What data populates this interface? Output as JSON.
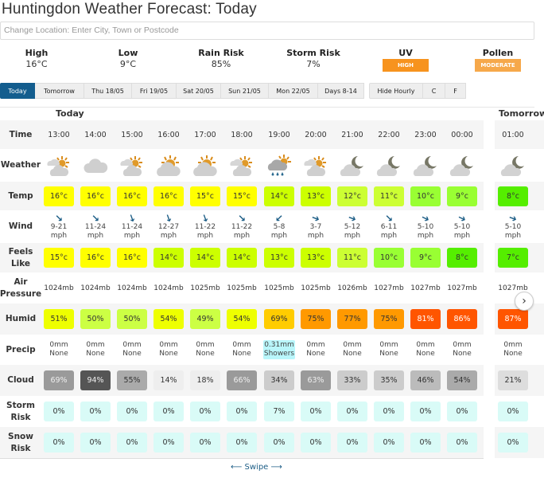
{
  "page_title": "Huntingdon Weather Forecast: Today",
  "location_input": {
    "placeholder": "Change Location: Enter City, Town or Postcode",
    "value": ""
  },
  "summary": {
    "high": {
      "label": "High",
      "value": "16°C"
    },
    "low": {
      "label": "Low",
      "value": "9°C"
    },
    "rain_risk": {
      "label": "Rain Risk",
      "value": "85%"
    },
    "storm_risk": {
      "label": "Storm Risk",
      "value": "7%"
    },
    "uv": {
      "label": "UV",
      "value": "HIGH",
      "color": "#f7931e"
    },
    "pollen": {
      "label": "Pollen",
      "value": "MODERATE",
      "color": "#f6a84a"
    }
  },
  "tabs": [
    {
      "label": "Today",
      "active": true
    },
    {
      "label": "Tomorrow"
    },
    {
      "label": "Thu 18/05"
    },
    {
      "label": "Fri 19/05"
    },
    {
      "label": "Sat 20/05"
    },
    {
      "label": "Sun 21/05"
    },
    {
      "label": "Mon 22/05"
    },
    {
      "label": "Days 8-14"
    }
  ],
  "controls": {
    "hide_hourly": "Hide Hourly",
    "celsius": "C",
    "fahrenheit": "F"
  },
  "day_headers": {
    "today": "Today",
    "tomorrow": "Tomorrow"
  },
  "row_labels": {
    "time": "Time",
    "weather": "Weather",
    "temp": "Temp",
    "wind": "Wind",
    "feels_line1": "Feels",
    "feels_line2": "Like",
    "air_line1": "Air",
    "air_line2": "Pressure",
    "humid": "Humid",
    "precip": "Precip",
    "cloud": "Cloud",
    "storm_line1": "Storm",
    "storm_line2": "Risk",
    "snow_line1": "Snow",
    "snow_line2": "Risk"
  },
  "hours": [
    {
      "day": "today",
      "time": "13:00",
      "icon": "sun-cloud",
      "temp": "16°c",
      "temp_color": "#ffff00",
      "wind_dir": "↘",
      "wind_rot": 0,
      "wind": "9-21",
      "wind_unit": "mph",
      "feels": "15°c",
      "feels_color": "#ffff00",
      "pressure": "1024mb",
      "humid": "51%",
      "humid_color": "#eeff00",
      "precip_amt": "0mm",
      "precip_type": "None",
      "precip_hl": false,
      "cloud": "69%",
      "cloud_color": "#9a9a9a",
      "cloud_text": "#eee",
      "storm": "0%",
      "snow": "0%"
    },
    {
      "day": "today",
      "time": "14:00",
      "icon": "cloud",
      "temp": "16°c",
      "temp_color": "#ffff00",
      "wind_dir": "↘",
      "wind_rot": 0,
      "wind": "11-24",
      "wind_unit": "mph",
      "feels": "16°c",
      "feels_color": "#ffff00",
      "pressure": "1024mb",
      "humid": "50%",
      "humid_color": "#ccff44",
      "precip_amt": "0mm",
      "precip_type": "None",
      "precip_hl": false,
      "cloud": "94%",
      "cloud_color": "#555555",
      "cloud_text": "#eee",
      "storm": "0%",
      "snow": "0%"
    },
    {
      "day": "today",
      "time": "15:00",
      "icon": "sun-cloud",
      "temp": "16°c",
      "temp_color": "#ffff00",
      "wind_dir": "↓",
      "wind_rot": -20,
      "wind": "11-24",
      "wind_unit": "mph",
      "feels": "16°c",
      "feels_color": "#ffff00",
      "pressure": "1024mb",
      "humid": "50%",
      "humid_color": "#ccff44",
      "precip_amt": "0mm",
      "precip_type": "None",
      "precip_hl": false,
      "cloud": "55%",
      "cloud_color": "#aaaaaa",
      "cloud_text": "#333",
      "storm": "0%",
      "snow": "0%"
    },
    {
      "day": "today",
      "time": "16:00",
      "icon": "sun-cloud-big",
      "temp": "16°c",
      "temp_color": "#ffff00",
      "wind_dir": "↓",
      "wind_rot": -20,
      "wind": "12-27",
      "wind_unit": "mph",
      "feels": "14°c",
      "feels_color": "#ccff00",
      "pressure": "1024mb",
      "humid": "54%",
      "humid_color": "#eeff00",
      "precip_amt": "0mm",
      "precip_type": "None",
      "precip_hl": false,
      "cloud": "14%",
      "cloud_color": "#eeeeee",
      "cloud_text": "#333",
      "storm": "0%",
      "snow": "0%"
    },
    {
      "day": "today",
      "time": "17:00",
      "icon": "sun-cloud-big",
      "temp": "15°c",
      "temp_color": "#ffff00",
      "wind_dir": "↓",
      "wind_rot": -20,
      "wind": "11-22",
      "wind_unit": "mph",
      "feels": "14°c",
      "feels_color": "#ccff00",
      "pressure": "1025mb",
      "humid": "49%",
      "humid_color": "#ccff44",
      "precip_amt": "0mm",
      "precip_type": "None",
      "precip_hl": false,
      "cloud": "18%",
      "cloud_color": "#eeeeee",
      "cloud_text": "#333",
      "storm": "0%",
      "snow": "0%"
    },
    {
      "day": "today",
      "time": "18:00",
      "icon": "sun-cloud",
      "temp": "15°c",
      "temp_color": "#ffff00",
      "wind_dir": "↘",
      "wind_rot": 0,
      "wind": "11-22",
      "wind_unit": "mph",
      "feels": "14°c",
      "feels_color": "#ccff00",
      "pressure": "1025mb",
      "humid": "54%",
      "humid_color": "#eeff00",
      "precip_amt": "0mm",
      "precip_type": "None",
      "precip_hl": false,
      "cloud": "66%",
      "cloud_color": "#9a9a9a",
      "cloud_text": "#eee",
      "storm": "0%",
      "snow": "0%"
    },
    {
      "day": "today",
      "time": "19:00",
      "icon": "sun-rain",
      "temp": "14°c",
      "temp_color": "#ccff00",
      "wind_dir": "↙",
      "wind_rot": 0,
      "wind": "5-8",
      "wind_unit": "mph",
      "feels": "13°c",
      "feels_color": "#ccff00",
      "pressure": "1025mb",
      "humid": "69%",
      "humid_color": "#ffcc00",
      "precip_amt": "0.31mm",
      "precip_type": "Showers",
      "precip_hl": true,
      "cloud": "34%",
      "cloud_color": "#cccccc",
      "cloud_text": "#333",
      "storm": "7%",
      "snow": "0%"
    },
    {
      "day": "today",
      "time": "20:00",
      "icon": "sun-cloud",
      "temp": "13°c",
      "temp_color": "#ccff00",
      "wind_dir": "➔",
      "wind_rot": 20,
      "wind": "3-7",
      "wind_unit": "mph",
      "feels": "13°c",
      "feels_color": "#ccff00",
      "pressure": "1025mb",
      "humid": "75%",
      "humid_color": "#ff9900",
      "precip_amt": "0mm",
      "precip_type": "None",
      "precip_hl": false,
      "cloud": "63%",
      "cloud_color": "#9a9a9a",
      "cloud_text": "#eee",
      "storm": "0%",
      "snow": "0%"
    },
    {
      "day": "today",
      "time": "21:00",
      "icon": "moon-cloud",
      "temp": "12°c",
      "temp_color": "#ccff33",
      "wind_dir": "➔",
      "wind_rot": 20,
      "wind": "5-12",
      "wind_unit": "mph",
      "feels": "11°c",
      "feels_color": "#ccff33",
      "pressure": "1026mb",
      "humid": "77%",
      "humid_color": "#ff9900",
      "precip_amt": "0mm",
      "precip_type": "None",
      "precip_hl": false,
      "cloud": "33%",
      "cloud_color": "#cccccc",
      "cloud_text": "#333",
      "storm": "0%",
      "snow": "0%"
    },
    {
      "day": "today",
      "time": "22:00",
      "icon": "moon-cloud",
      "temp": "11°c",
      "temp_color": "#ccff33",
      "wind_dir": "↘",
      "wind_rot": 0,
      "wind": "6-11",
      "wind_unit": "mph",
      "feels": "10°c",
      "feels_color": "#99ff33",
      "pressure": "1027mb",
      "humid": "75%",
      "humid_color": "#ff9900",
      "precip_amt": "0mm",
      "precip_type": "None",
      "precip_hl": false,
      "cloud": "35%",
      "cloud_color": "#cccccc",
      "cloud_text": "#333",
      "storm": "0%",
      "snow": "0%"
    },
    {
      "day": "today",
      "time": "23:00",
      "icon": "moon-cloud",
      "temp": "10°c",
      "temp_color": "#99ff33",
      "wind_dir": "➔",
      "wind_rot": 25,
      "wind": "5-10",
      "wind_unit": "mph",
      "feels": "9°c",
      "feels_color": "#99ff33",
      "pressure": "1027mb",
      "humid": "81%",
      "humid_color": "#ff5500",
      "precip_amt": "0mm",
      "precip_type": "None",
      "precip_hl": false,
      "cloud": "46%",
      "cloud_color": "#bbbbbb",
      "cloud_text": "#333",
      "storm": "0%",
      "snow": "0%"
    },
    {
      "day": "today",
      "time": "00:00",
      "icon": "moon-cloud",
      "temp": "9°c",
      "temp_color": "#99ff33",
      "wind_dir": "➔",
      "wind_rot": 25,
      "wind": "5-10",
      "wind_unit": "mph",
      "feels": "8°c",
      "feels_color": "#55ee00",
      "pressure": "1027mb",
      "humid": "86%",
      "humid_color": "#ff5500",
      "precip_amt": "0mm",
      "precip_type": "None",
      "precip_hl": false,
      "cloud": "54%",
      "cloud_color": "#aaaaaa",
      "cloud_text": "#333",
      "storm": "0%",
      "snow": "0%"
    },
    {
      "day": "tomorrow",
      "time": "01:00",
      "icon": "moon-cloud",
      "temp": "8°c",
      "temp_color": "#55ee00",
      "wind_dir": "➔",
      "wind_rot": 20,
      "wind": "5-10",
      "wind_unit": "mph",
      "feels": "7°c",
      "feels_color": "#55ee00",
      "pressure": "1027mb",
      "humid": "87%",
      "humid_color": "#ff5500",
      "precip_amt": "0mm",
      "precip_type": "None",
      "precip_hl": false,
      "cloud": "21%",
      "cloud_color": "#dddddd",
      "cloud_text": "#333",
      "storm": "0%",
      "snow": "0%"
    }
  ],
  "risk_color": "#d9fbf7",
  "swipe_label": "Swipe",
  "next_button": "›"
}
